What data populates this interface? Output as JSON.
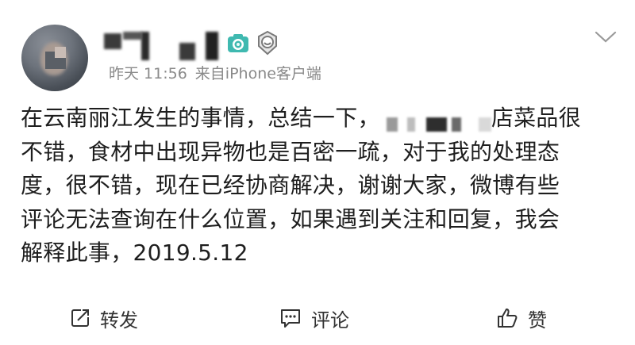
{
  "post": {
    "time": "昨天 11:56",
    "source": "来自iPhone客户端",
    "lines": [
      {
        "before": "在云南丽江发生的事情，总结一下，",
        "after": "店菜品很"
      },
      {
        "text": "不错，食材中出现异物也是百密一疏，对于我的处理态"
      },
      {
        "text": "度，很不错，现在已经协商解决，谢谢大家，微博有些"
      },
      {
        "text": "评论无法查询在什么位置，如果遇到关注和回复，我会"
      },
      {
        "text": "解释此事，2019.5.12"
      }
    ]
  },
  "actions": {
    "repost": "转发",
    "comment": "评论",
    "like": "赞"
  },
  "icons": {
    "camera": "camera-icon",
    "badge": "member-badge-icon",
    "menu": "chevron-down-icon",
    "repost": "repost-icon",
    "comment": "comment-icon",
    "like": "thumbs-up-icon"
  },
  "colors": {
    "text": "#1e1e1e",
    "meta": "#8a8a8a",
    "camera_badge": "#3fb9b0"
  }
}
